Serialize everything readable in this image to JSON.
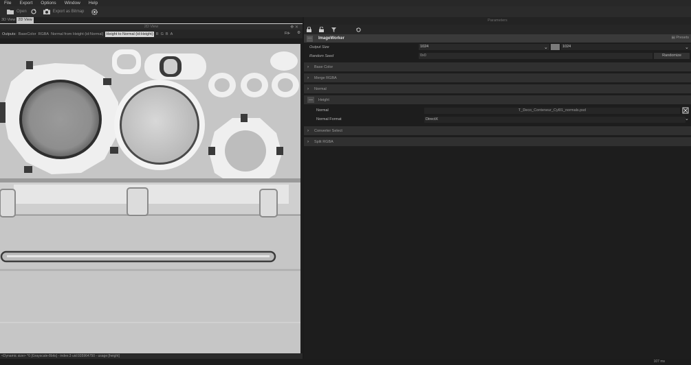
{
  "menu": [
    "File",
    "Export",
    "Options",
    "Window",
    "Help"
  ],
  "toolbar": {
    "open_label": "Open",
    "export_label": "Export as Bitmap"
  },
  "tabs": [
    "3D View",
    "2D View"
  ],
  "view_header": {
    "title": "2D View"
  },
  "outputs": {
    "label": "Outputs:",
    "items": [
      "BaseColor",
      "RGBA",
      "Normal from Height (id:Normal)",
      "Height to Normal (id:Height)"
    ],
    "selected_index": 3,
    "channels": [
      "R",
      "G",
      "B",
      "A"
    ],
    "zoom": "Fit"
  },
  "status": {
    "text": "<Dynamic size> ^0 [Grayscale-8bits] - index:3 uid:935964750 - usage:[height]",
    "timing": "107 ms"
  },
  "params": {
    "title": "Parameters",
    "worker": "ImageWorker",
    "presets": "Presets",
    "output_size": {
      "label": "Output Size",
      "value1": "1024",
      "value2": "1024"
    },
    "random_seed": {
      "label": "Random Seed",
      "value": "0x0",
      "button": "Randomize"
    },
    "sections": [
      "Base Color",
      "Merge RGBA",
      "Normal",
      "Height",
      "Converter Select",
      "Split RGBA"
    ],
    "height": {
      "normal_label": "Normal",
      "normal_value": "T_Deco_Conteneur_Cyl01_normals.psd",
      "format_label": "Normal Format",
      "format_value": "DirectX"
    }
  }
}
